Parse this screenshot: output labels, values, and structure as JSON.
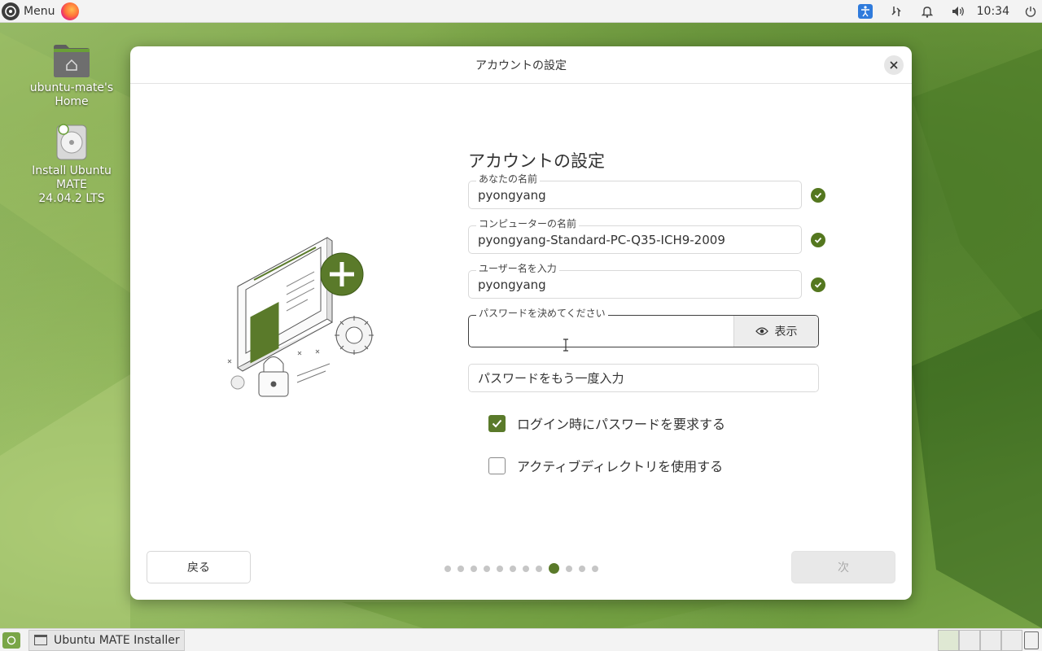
{
  "top_panel": {
    "menu_label": "Menu",
    "clock": "10:34"
  },
  "desktop": {
    "icons": [
      {
        "label_line1": "ubuntu-mate's",
        "label_line2": "Home"
      },
      {
        "label_line1": "Install Ubuntu MATE",
        "label_line2": "24.04.2 LTS"
      }
    ]
  },
  "dialog": {
    "title": "アカウントの設定",
    "heading": "アカウントの設定",
    "fields": {
      "your_name": {
        "label": "あなたの名前",
        "value": "pyongyang"
      },
      "computer_name": {
        "label": "コンピューターの名前",
        "value": "pyongyang-Standard-PC-Q35-ICH9-2009"
      },
      "username": {
        "label": "ユーザー名を入力",
        "value": "pyongyang"
      },
      "password": {
        "label": "パスワードを決めてください",
        "value": "",
        "show_label": "表示"
      },
      "confirm_password": {
        "placeholder": "パスワードをもう一度入力"
      }
    },
    "checkboxes": [
      {
        "label": "ログイン時にパスワードを要求する",
        "checked": true
      },
      {
        "label": "アクティブディレクトリを使用する",
        "checked": false
      }
    ],
    "back_label": "戻る",
    "next_label": "次",
    "progress": {
      "total_steps": 12,
      "current_step": 9
    }
  },
  "taskbar": {
    "window_title": "Ubuntu MATE Installer"
  },
  "colors": {
    "accent": "#5a7a2a",
    "check_ok": "#54771f"
  }
}
